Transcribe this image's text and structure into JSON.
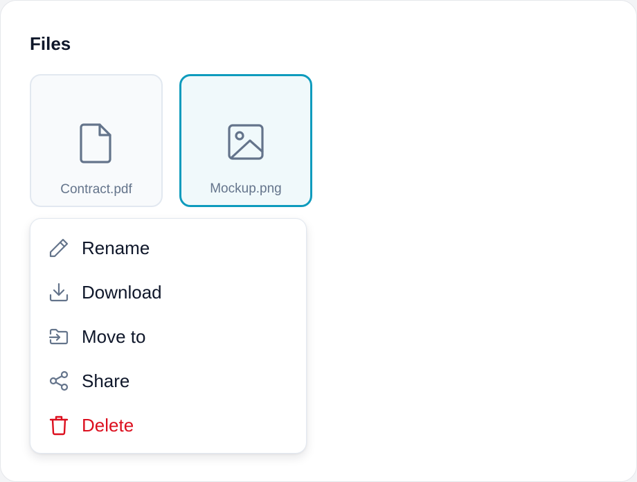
{
  "section": {
    "title": "Files"
  },
  "files": [
    {
      "name": "Contract.pdf",
      "icon": "file-icon",
      "selected": false
    },
    {
      "name": "Mockup.png",
      "icon": "image-icon",
      "selected": true
    }
  ],
  "menu": {
    "items": [
      {
        "label": "Rename",
        "icon": "pencil-icon"
      },
      {
        "label": "Download",
        "icon": "download-icon"
      },
      {
        "label": "Move to",
        "icon": "folder-move-icon"
      },
      {
        "label": "Share",
        "icon": "share-icon"
      },
      {
        "label": "Delete",
        "icon": "trash-icon",
        "danger": true
      }
    ]
  },
  "colors": {
    "accent": "#0e9bbd",
    "danger": "#dc0f1e",
    "icon": "#64748b",
    "text": "#0f172a"
  }
}
